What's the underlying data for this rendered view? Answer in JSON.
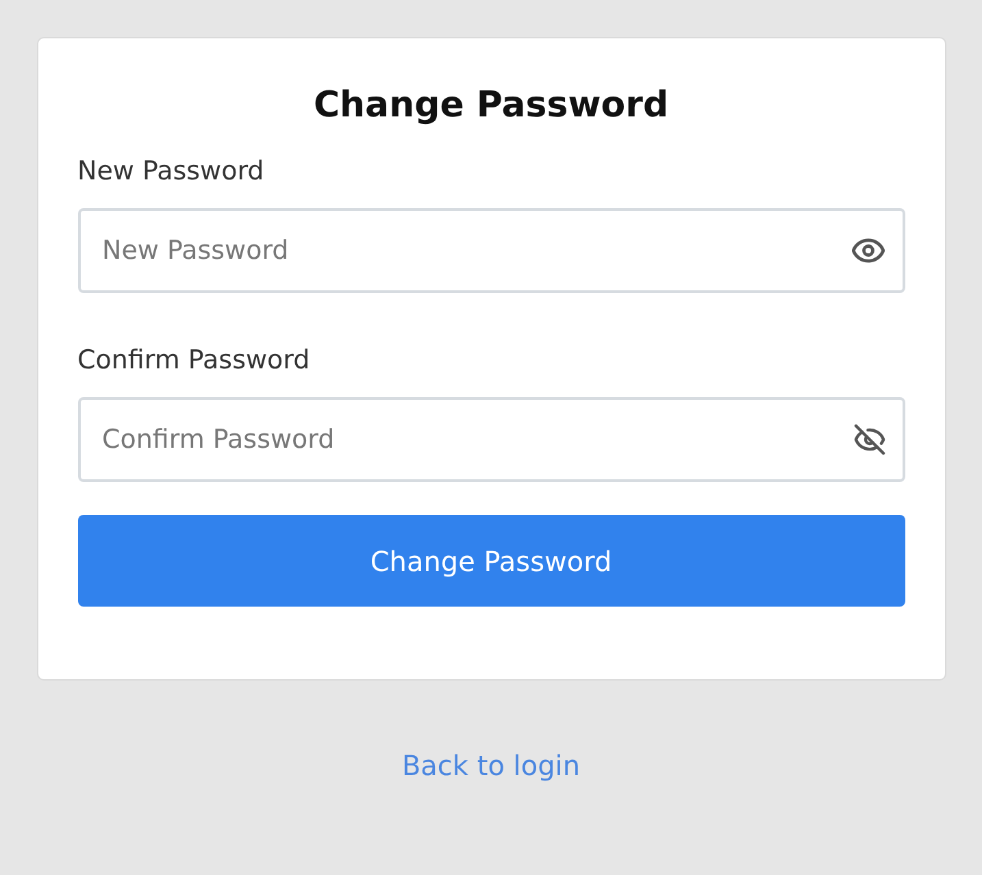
{
  "form": {
    "title": "Change Password",
    "fields": [
      {
        "label": "New Password",
        "placeholder": "New Password",
        "masked": false
      },
      {
        "label": "Confirm Password",
        "placeholder": "Confirm Password",
        "masked": true
      }
    ],
    "submit": "Change Password"
  },
  "back_link": "Back to login"
}
